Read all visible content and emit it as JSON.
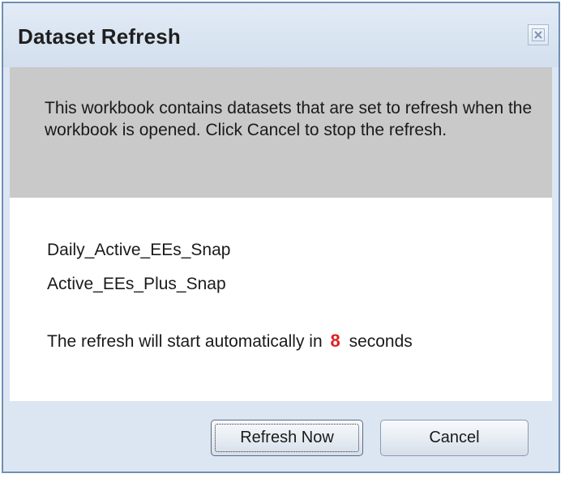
{
  "dialog": {
    "title": "Dataset Refresh",
    "close_icon": "close-icon"
  },
  "info": {
    "message": "This workbook contains datasets that are set to refresh when the workbook is opened. Click Cancel to stop the refresh."
  },
  "datasets": [
    "Daily_Active_EEs_Snap",
    "Active_EEs_Plus_Snap"
  ],
  "countdown": {
    "prefix": "The refresh will start automatically in",
    "seconds": "8",
    "suffix": "seconds",
    "highlight_color": "#e02020"
  },
  "buttons": {
    "refresh_now": "Refresh Now",
    "cancel": "Cancel"
  }
}
